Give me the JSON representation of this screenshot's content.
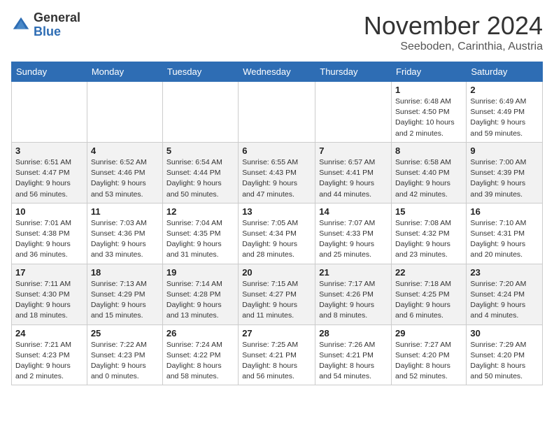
{
  "logo": {
    "general": "General",
    "blue": "Blue"
  },
  "title": {
    "month": "November 2024",
    "location": "Seeboden, Carinthia, Austria"
  },
  "headers": [
    "Sunday",
    "Monday",
    "Tuesday",
    "Wednesday",
    "Thursday",
    "Friday",
    "Saturday"
  ],
  "weeks": [
    [
      {
        "day": "",
        "info": ""
      },
      {
        "day": "",
        "info": ""
      },
      {
        "day": "",
        "info": ""
      },
      {
        "day": "",
        "info": ""
      },
      {
        "day": "",
        "info": ""
      },
      {
        "day": "1",
        "info": "Sunrise: 6:48 AM\nSunset: 4:50 PM\nDaylight: 10 hours\nand 2 minutes."
      },
      {
        "day": "2",
        "info": "Sunrise: 6:49 AM\nSunset: 4:49 PM\nDaylight: 9 hours\nand 59 minutes."
      }
    ],
    [
      {
        "day": "3",
        "info": "Sunrise: 6:51 AM\nSunset: 4:47 PM\nDaylight: 9 hours\nand 56 minutes."
      },
      {
        "day": "4",
        "info": "Sunrise: 6:52 AM\nSunset: 4:46 PM\nDaylight: 9 hours\nand 53 minutes."
      },
      {
        "day": "5",
        "info": "Sunrise: 6:54 AM\nSunset: 4:44 PM\nDaylight: 9 hours\nand 50 minutes."
      },
      {
        "day": "6",
        "info": "Sunrise: 6:55 AM\nSunset: 4:43 PM\nDaylight: 9 hours\nand 47 minutes."
      },
      {
        "day": "7",
        "info": "Sunrise: 6:57 AM\nSunset: 4:41 PM\nDaylight: 9 hours\nand 44 minutes."
      },
      {
        "day": "8",
        "info": "Sunrise: 6:58 AM\nSunset: 4:40 PM\nDaylight: 9 hours\nand 42 minutes."
      },
      {
        "day": "9",
        "info": "Sunrise: 7:00 AM\nSunset: 4:39 PM\nDaylight: 9 hours\nand 39 minutes."
      }
    ],
    [
      {
        "day": "10",
        "info": "Sunrise: 7:01 AM\nSunset: 4:38 PM\nDaylight: 9 hours\nand 36 minutes."
      },
      {
        "day": "11",
        "info": "Sunrise: 7:03 AM\nSunset: 4:36 PM\nDaylight: 9 hours\nand 33 minutes."
      },
      {
        "day": "12",
        "info": "Sunrise: 7:04 AM\nSunset: 4:35 PM\nDaylight: 9 hours\nand 31 minutes."
      },
      {
        "day": "13",
        "info": "Sunrise: 7:05 AM\nSunset: 4:34 PM\nDaylight: 9 hours\nand 28 minutes."
      },
      {
        "day": "14",
        "info": "Sunrise: 7:07 AM\nSunset: 4:33 PM\nDaylight: 9 hours\nand 25 minutes."
      },
      {
        "day": "15",
        "info": "Sunrise: 7:08 AM\nSunset: 4:32 PM\nDaylight: 9 hours\nand 23 minutes."
      },
      {
        "day": "16",
        "info": "Sunrise: 7:10 AM\nSunset: 4:31 PM\nDaylight: 9 hours\nand 20 minutes."
      }
    ],
    [
      {
        "day": "17",
        "info": "Sunrise: 7:11 AM\nSunset: 4:30 PM\nDaylight: 9 hours\nand 18 minutes."
      },
      {
        "day": "18",
        "info": "Sunrise: 7:13 AM\nSunset: 4:29 PM\nDaylight: 9 hours\nand 15 minutes."
      },
      {
        "day": "19",
        "info": "Sunrise: 7:14 AM\nSunset: 4:28 PM\nDaylight: 9 hours\nand 13 minutes."
      },
      {
        "day": "20",
        "info": "Sunrise: 7:15 AM\nSunset: 4:27 PM\nDaylight: 9 hours\nand 11 minutes."
      },
      {
        "day": "21",
        "info": "Sunrise: 7:17 AM\nSunset: 4:26 PM\nDaylight: 9 hours\nand 8 minutes."
      },
      {
        "day": "22",
        "info": "Sunrise: 7:18 AM\nSunset: 4:25 PM\nDaylight: 9 hours\nand 6 minutes."
      },
      {
        "day": "23",
        "info": "Sunrise: 7:20 AM\nSunset: 4:24 PM\nDaylight: 9 hours\nand 4 minutes."
      }
    ],
    [
      {
        "day": "24",
        "info": "Sunrise: 7:21 AM\nSunset: 4:23 PM\nDaylight: 9 hours\nand 2 minutes."
      },
      {
        "day": "25",
        "info": "Sunrise: 7:22 AM\nSunset: 4:23 PM\nDaylight: 9 hours\nand 0 minutes."
      },
      {
        "day": "26",
        "info": "Sunrise: 7:24 AM\nSunset: 4:22 PM\nDaylight: 8 hours\nand 58 minutes."
      },
      {
        "day": "27",
        "info": "Sunrise: 7:25 AM\nSunset: 4:21 PM\nDaylight: 8 hours\nand 56 minutes."
      },
      {
        "day": "28",
        "info": "Sunrise: 7:26 AM\nSunset: 4:21 PM\nDaylight: 8 hours\nand 54 minutes."
      },
      {
        "day": "29",
        "info": "Sunrise: 7:27 AM\nSunset: 4:20 PM\nDaylight: 8 hours\nand 52 minutes."
      },
      {
        "day": "30",
        "info": "Sunrise: 7:29 AM\nSunset: 4:20 PM\nDaylight: 8 hours\nand 50 minutes."
      }
    ]
  ]
}
